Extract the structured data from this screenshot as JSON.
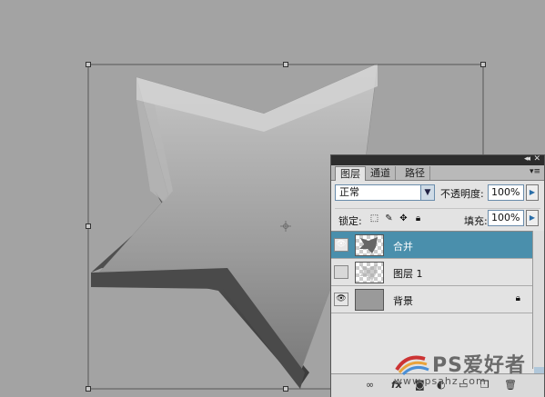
{
  "panel": {
    "collapse_icon": "collapse-arrows-icon",
    "close_icon": "close-icon",
    "tabs": [
      {
        "label": "图层",
        "active": true
      },
      {
        "label": "通道",
        "active": false
      },
      {
        "label": "路径",
        "active": false
      }
    ],
    "blend_mode": "正常",
    "opacity_label": "不透明度:",
    "opacity_value": "100%",
    "lock_label": "锁定:",
    "fill_label": "填充:",
    "fill_value": "100%",
    "layers": [
      {
        "name": "合并",
        "visible": true,
        "selected": true,
        "thumb": "star-shape"
      },
      {
        "name": "图层 1",
        "visible": false,
        "selected": false,
        "thumb": "star-shape"
      },
      {
        "name": "背景",
        "visible": true,
        "selected": false,
        "thumb": "gray-fill",
        "locked": true
      }
    ],
    "bottom_icons": [
      "link-icon",
      "fx-icon",
      "mask-icon",
      "adjustment-icon",
      "group-icon",
      "new-layer-icon",
      "trash-icon"
    ]
  },
  "colors": {
    "canvas_bg": "#a3a3a3",
    "selected_layer": "#4a8fac"
  },
  "watermark": {
    "brand": "PS爱好者",
    "url": "www.psahz.com"
  }
}
